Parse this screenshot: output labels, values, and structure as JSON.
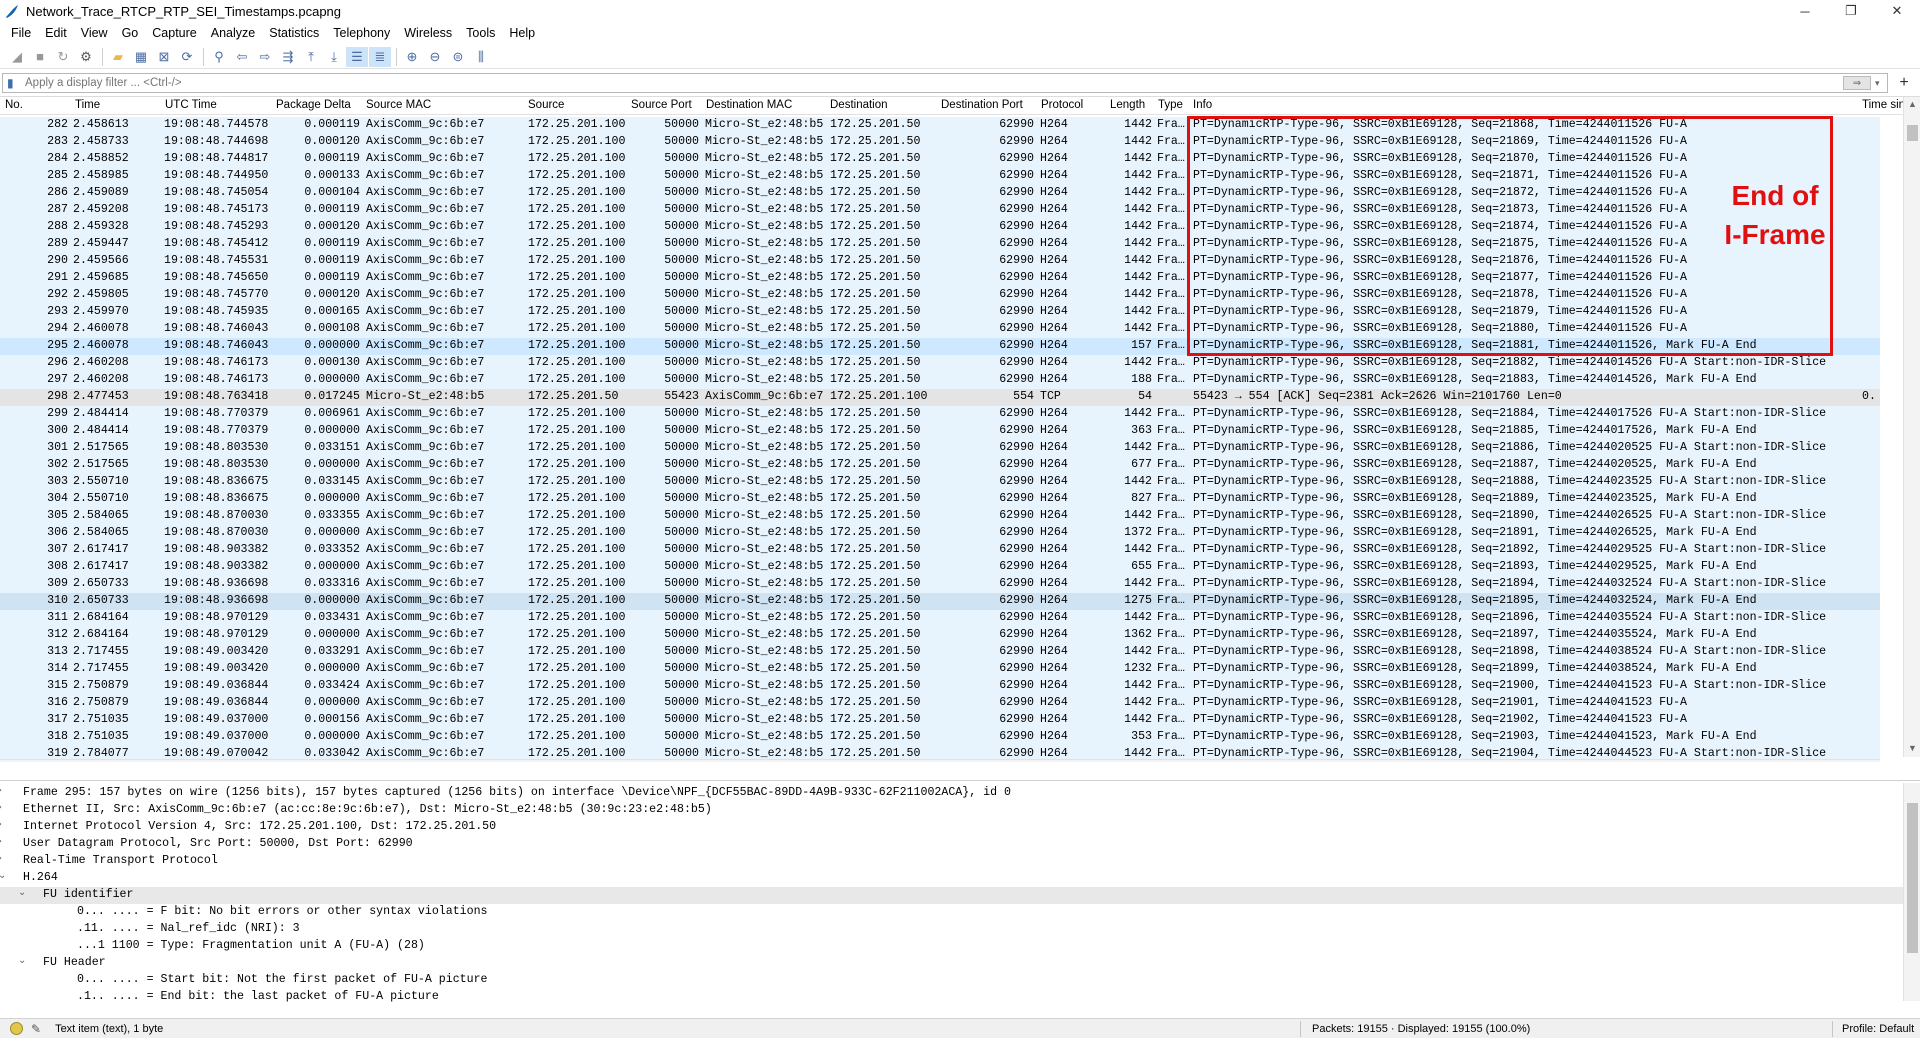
{
  "window": {
    "title": "Network_Trace_RTCP_RTP_SEI_Timestamps.pcapng"
  },
  "menu": [
    "File",
    "Edit",
    "View",
    "Go",
    "Capture",
    "Analyze",
    "Statistics",
    "Telephony",
    "Wireless",
    "Tools",
    "Help"
  ],
  "filter": {
    "placeholder": "Apply a display filter ... <Ctrl-/>"
  },
  "columns": {
    "no": "No.",
    "time": "Time",
    "utc": "UTC Time",
    "delta": "Package Delta",
    "smac": "Source MAC",
    "src": "Source",
    "sport": "Source Port",
    "dmac": "Destination MAC",
    "dst": "Destination",
    "dport": "Destination Port",
    "proto": "Protocol",
    "len": "Length",
    "type": "Type",
    "info": "Info",
    "tsin": "Time sin"
  },
  "rows": [
    [
      "282",
      "2.458613",
      "19:08:48.744578",
      "0.000119",
      "AxisComm_9c:6b:e7",
      "172.25.201.100",
      "50000",
      "Micro-St_e2:48:b5",
      "172.25.201.50",
      "62990",
      "H264",
      "1442",
      "Fra…",
      "PT=DynamicRTP-Type-96, SSRC=0xB1E69128, Seq=21868, Time=4244011526 FU-A",
      ""
    ],
    [
      "283",
      "2.458733",
      "19:08:48.744698",
      "0.000120",
      "AxisComm_9c:6b:e7",
      "172.25.201.100",
      "50000",
      "Micro-St_e2:48:b5",
      "172.25.201.50",
      "62990",
      "H264",
      "1442",
      "Fra…",
      "PT=DynamicRTP-Type-96, SSRC=0xB1E69128, Seq=21869, Time=4244011526 FU-A",
      ""
    ],
    [
      "284",
      "2.458852",
      "19:08:48.744817",
      "0.000119",
      "AxisComm_9c:6b:e7",
      "172.25.201.100",
      "50000",
      "Micro-St_e2:48:b5",
      "172.25.201.50",
      "62990",
      "H264",
      "1442",
      "Fra…",
      "PT=DynamicRTP-Type-96, SSRC=0xB1E69128, Seq=21870, Time=4244011526 FU-A",
      ""
    ],
    [
      "285",
      "2.458985",
      "19:08:48.744950",
      "0.000133",
      "AxisComm_9c:6b:e7",
      "172.25.201.100",
      "50000",
      "Micro-St_e2:48:b5",
      "172.25.201.50",
      "62990",
      "H264",
      "1442",
      "Fra…",
      "PT=DynamicRTP-Type-96, SSRC=0xB1E69128, Seq=21871, Time=4244011526 FU-A",
      ""
    ],
    [
      "286",
      "2.459089",
      "19:08:48.745054",
      "0.000104",
      "AxisComm_9c:6b:e7",
      "172.25.201.100",
      "50000",
      "Micro-St_e2:48:b5",
      "172.25.201.50",
      "62990",
      "H264",
      "1442",
      "Fra…",
      "PT=DynamicRTP-Type-96, SSRC=0xB1E69128, Seq=21872, Time=4244011526 FU-A",
      ""
    ],
    [
      "287",
      "2.459208",
      "19:08:48.745173",
      "0.000119",
      "AxisComm_9c:6b:e7",
      "172.25.201.100",
      "50000",
      "Micro-St_e2:48:b5",
      "172.25.201.50",
      "62990",
      "H264",
      "1442",
      "Fra…",
      "PT=DynamicRTP-Type-96, SSRC=0xB1E69128, Seq=21873, Time=4244011526 FU-A",
      ""
    ],
    [
      "288",
      "2.459328",
      "19:08:48.745293",
      "0.000120",
      "AxisComm_9c:6b:e7",
      "172.25.201.100",
      "50000",
      "Micro-St_e2:48:b5",
      "172.25.201.50",
      "62990",
      "H264",
      "1442",
      "Fra…",
      "PT=DynamicRTP-Type-96, SSRC=0xB1E69128, Seq=21874, Time=4244011526 FU-A",
      ""
    ],
    [
      "289",
      "2.459447",
      "19:08:48.745412",
      "0.000119",
      "AxisComm_9c:6b:e7",
      "172.25.201.100",
      "50000",
      "Micro-St_e2:48:b5",
      "172.25.201.50",
      "62990",
      "H264",
      "1442",
      "Fra…",
      "PT=DynamicRTP-Type-96, SSRC=0xB1E69128, Seq=21875, Time=4244011526 FU-A",
      ""
    ],
    [
      "290",
      "2.459566",
      "19:08:48.745531",
      "0.000119",
      "AxisComm_9c:6b:e7",
      "172.25.201.100",
      "50000",
      "Micro-St_e2:48:b5",
      "172.25.201.50",
      "62990",
      "H264",
      "1442",
      "Fra…",
      "PT=DynamicRTP-Type-96, SSRC=0xB1E69128, Seq=21876, Time=4244011526 FU-A",
      ""
    ],
    [
      "291",
      "2.459685",
      "19:08:48.745650",
      "0.000119",
      "AxisComm_9c:6b:e7",
      "172.25.201.100",
      "50000",
      "Micro-St_e2:48:b5",
      "172.25.201.50",
      "62990",
      "H264",
      "1442",
      "Fra…",
      "PT=DynamicRTP-Type-96, SSRC=0xB1E69128, Seq=21877, Time=4244011526 FU-A",
      ""
    ],
    [
      "292",
      "2.459805",
      "19:08:48.745770",
      "0.000120",
      "AxisComm_9c:6b:e7",
      "172.25.201.100",
      "50000",
      "Micro-St_e2:48:b5",
      "172.25.201.50",
      "62990",
      "H264",
      "1442",
      "Fra…",
      "PT=DynamicRTP-Type-96, SSRC=0xB1E69128, Seq=21878, Time=4244011526 FU-A",
      ""
    ],
    [
      "293",
      "2.459970",
      "19:08:48.745935",
      "0.000165",
      "AxisComm_9c:6b:e7",
      "172.25.201.100",
      "50000",
      "Micro-St_e2:48:b5",
      "172.25.201.50",
      "62990",
      "H264",
      "1442",
      "Fra…",
      "PT=DynamicRTP-Type-96, SSRC=0xB1E69128, Seq=21879, Time=4244011526 FU-A",
      ""
    ],
    [
      "294",
      "2.460078",
      "19:08:48.746043",
      "0.000108",
      "AxisComm_9c:6b:e7",
      "172.25.201.100",
      "50000",
      "Micro-St_e2:48:b5",
      "172.25.201.50",
      "62990",
      "H264",
      "1442",
      "Fra…",
      "PT=DynamicRTP-Type-96, SSRC=0xB1E69128, Seq=21880, Time=4244011526 FU-A",
      ""
    ],
    [
      "295",
      "2.460078",
      "19:08:48.746043",
      "0.000000",
      "AxisComm_9c:6b:e7",
      "172.25.201.100",
      "50000",
      "Micro-St_e2:48:b5",
      "172.25.201.50",
      "62990",
      "H264",
      "157",
      "Fra…",
      "PT=DynamicRTP-Type-96, SSRC=0xB1E69128, Seq=21881, Time=4244011526, Mark FU-A End",
      ""
    ],
    [
      "296",
      "2.460208",
      "19:08:48.746173",
      "0.000130",
      "AxisComm_9c:6b:e7",
      "172.25.201.100",
      "50000",
      "Micro-St_e2:48:b5",
      "172.25.201.50",
      "62990",
      "H264",
      "1442",
      "Fra…",
      "PT=DynamicRTP-Type-96, SSRC=0xB1E69128, Seq=21882, Time=4244014526 FU-A Start:non-IDR-Slice",
      ""
    ],
    [
      "297",
      "2.460208",
      "19:08:48.746173",
      "0.000000",
      "AxisComm_9c:6b:e7",
      "172.25.201.100",
      "50000",
      "Micro-St_e2:48:b5",
      "172.25.201.50",
      "62990",
      "H264",
      "188",
      "Fra…",
      "PT=DynamicRTP-Type-96, SSRC=0xB1E69128, Seq=21883, Time=4244014526, Mark FU-A End",
      ""
    ],
    [
      "298",
      "2.477453",
      "19:08:48.763418",
      "0.017245",
      "Micro-St_e2:48:b5",
      "172.25.201.50",
      "55423",
      "AxisComm_9c:6b:e7",
      "172.25.201.100",
      "554",
      "TCP",
      "54",
      "",
      "55423 → 554 [ACK] Seq=2381 Ack=2626 Win=2101760 Len=0",
      "0."
    ],
    [
      "299",
      "2.484414",
      "19:08:48.770379",
      "0.006961",
      "AxisComm_9c:6b:e7",
      "172.25.201.100",
      "50000",
      "Micro-St_e2:48:b5",
      "172.25.201.50",
      "62990",
      "H264",
      "1442",
      "Fra…",
      "PT=DynamicRTP-Type-96, SSRC=0xB1E69128, Seq=21884, Time=4244017526 FU-A Start:non-IDR-Slice",
      ""
    ],
    [
      "300",
      "2.484414",
      "19:08:48.770379",
      "0.000000",
      "AxisComm_9c:6b:e7",
      "172.25.201.100",
      "50000",
      "Micro-St_e2:48:b5",
      "172.25.201.50",
      "62990",
      "H264",
      "363",
      "Fra…",
      "PT=DynamicRTP-Type-96, SSRC=0xB1E69128, Seq=21885, Time=4244017526, Mark FU-A End",
      ""
    ],
    [
      "301",
      "2.517565",
      "19:08:48.803530",
      "0.033151",
      "AxisComm_9c:6b:e7",
      "172.25.201.100",
      "50000",
      "Micro-St_e2:48:b5",
      "172.25.201.50",
      "62990",
      "H264",
      "1442",
      "Fra…",
      "PT=DynamicRTP-Type-96, SSRC=0xB1E69128, Seq=21886, Time=4244020525 FU-A Start:non-IDR-Slice",
      ""
    ],
    [
      "302",
      "2.517565",
      "19:08:48.803530",
      "0.000000",
      "AxisComm_9c:6b:e7",
      "172.25.201.100",
      "50000",
      "Micro-St_e2:48:b5",
      "172.25.201.50",
      "62990",
      "H264",
      "677",
      "Fra…",
      "PT=DynamicRTP-Type-96, SSRC=0xB1E69128, Seq=21887, Time=4244020525, Mark FU-A End",
      ""
    ],
    [
      "303",
      "2.550710",
      "19:08:48.836675",
      "0.033145",
      "AxisComm_9c:6b:e7",
      "172.25.201.100",
      "50000",
      "Micro-St_e2:48:b5",
      "172.25.201.50",
      "62990",
      "H264",
      "1442",
      "Fra…",
      "PT=DynamicRTP-Type-96, SSRC=0xB1E69128, Seq=21888, Time=4244023525 FU-A Start:non-IDR-Slice",
      ""
    ],
    [
      "304",
      "2.550710",
      "19:08:48.836675",
      "0.000000",
      "AxisComm_9c:6b:e7",
      "172.25.201.100",
      "50000",
      "Micro-St_e2:48:b5",
      "172.25.201.50",
      "62990",
      "H264",
      "827",
      "Fra…",
      "PT=DynamicRTP-Type-96, SSRC=0xB1E69128, Seq=21889, Time=4244023525, Mark FU-A End",
      ""
    ],
    [
      "305",
      "2.584065",
      "19:08:48.870030",
      "0.033355",
      "AxisComm_9c:6b:e7",
      "172.25.201.100",
      "50000",
      "Micro-St_e2:48:b5",
      "172.25.201.50",
      "62990",
      "H264",
      "1442",
      "Fra…",
      "PT=DynamicRTP-Type-96, SSRC=0xB1E69128, Seq=21890, Time=4244026525 FU-A Start:non-IDR-Slice",
      ""
    ],
    [
      "306",
      "2.584065",
      "19:08:48.870030",
      "0.000000",
      "AxisComm_9c:6b:e7",
      "172.25.201.100",
      "50000",
      "Micro-St_e2:48:b5",
      "172.25.201.50",
      "62990",
      "H264",
      "1372",
      "Fra…",
      "PT=DynamicRTP-Type-96, SSRC=0xB1E69128, Seq=21891, Time=4244026525, Mark FU-A End",
      ""
    ],
    [
      "307",
      "2.617417",
      "19:08:48.903382",
      "0.033352",
      "AxisComm_9c:6b:e7",
      "172.25.201.100",
      "50000",
      "Micro-St_e2:48:b5",
      "172.25.201.50",
      "62990",
      "H264",
      "1442",
      "Fra…",
      "PT=DynamicRTP-Type-96, SSRC=0xB1E69128, Seq=21892, Time=4244029525 FU-A Start:non-IDR-Slice",
      ""
    ],
    [
      "308",
      "2.617417",
      "19:08:48.903382",
      "0.000000",
      "AxisComm_9c:6b:e7",
      "172.25.201.100",
      "50000",
      "Micro-St_e2:48:b5",
      "172.25.201.50",
      "62990",
      "H264",
      "655",
      "Fra…",
      "PT=DynamicRTP-Type-96, SSRC=0xB1E69128, Seq=21893, Time=4244029525, Mark FU-A End",
      ""
    ],
    [
      "309",
      "2.650733",
      "19:08:48.936698",
      "0.033316",
      "AxisComm_9c:6b:e7",
      "172.25.201.100",
      "50000",
      "Micro-St_e2:48:b5",
      "172.25.201.50",
      "62990",
      "H264",
      "1442",
      "Fra…",
      "PT=DynamicRTP-Type-96, SSRC=0xB1E69128, Seq=21894, Time=4244032524 FU-A Start:non-IDR-Slice",
      ""
    ],
    [
      "310",
      "2.650733",
      "19:08:48.936698",
      "0.000000",
      "AxisComm_9c:6b:e7",
      "172.25.201.100",
      "50000",
      "Micro-St_e2:48:b5",
      "172.25.201.50",
      "62990",
      "H264",
      "1275",
      "Fra…",
      "PT=DynamicRTP-Type-96, SSRC=0xB1E69128, Seq=21895, Time=4244032524, Mark FU-A End",
      ""
    ],
    [
      "311",
      "2.684164",
      "19:08:48.970129",
      "0.033431",
      "AxisComm_9c:6b:e7",
      "172.25.201.100",
      "50000",
      "Micro-St_e2:48:b5",
      "172.25.201.50",
      "62990",
      "H264",
      "1442",
      "Fra…",
      "PT=DynamicRTP-Type-96, SSRC=0xB1E69128, Seq=21896, Time=4244035524 FU-A Start:non-IDR-Slice",
      ""
    ],
    [
      "312",
      "2.684164",
      "19:08:48.970129",
      "0.000000",
      "AxisComm_9c:6b:e7",
      "172.25.201.100",
      "50000",
      "Micro-St_e2:48:b5",
      "172.25.201.50",
      "62990",
      "H264",
      "1362",
      "Fra…",
      "PT=DynamicRTP-Type-96, SSRC=0xB1E69128, Seq=21897, Time=4244035524, Mark FU-A End",
      ""
    ],
    [
      "313",
      "2.717455",
      "19:08:49.003420",
      "0.033291",
      "AxisComm_9c:6b:e7",
      "172.25.201.100",
      "50000",
      "Micro-St_e2:48:b5",
      "172.25.201.50",
      "62990",
      "H264",
      "1442",
      "Fra…",
      "PT=DynamicRTP-Type-96, SSRC=0xB1E69128, Seq=21898, Time=4244038524 FU-A Start:non-IDR-Slice",
      ""
    ],
    [
      "314",
      "2.717455",
      "19:08:49.003420",
      "0.000000",
      "AxisComm_9c:6b:e7",
      "172.25.201.100",
      "50000",
      "Micro-St_e2:48:b5",
      "172.25.201.50",
      "62990",
      "H264",
      "1232",
      "Fra…",
      "PT=DynamicRTP-Type-96, SSRC=0xB1E69128, Seq=21899, Time=4244038524, Mark FU-A End",
      ""
    ],
    [
      "315",
      "2.750879",
      "19:08:49.036844",
      "0.033424",
      "AxisComm_9c:6b:e7",
      "172.25.201.100",
      "50000",
      "Micro-St_e2:48:b5",
      "172.25.201.50",
      "62990",
      "H264",
      "1442",
      "Fra…",
      "PT=DynamicRTP-Type-96, SSRC=0xB1E69128, Seq=21900, Time=4244041523 FU-A Start:non-IDR-Slice",
      ""
    ],
    [
      "316",
      "2.750879",
      "19:08:49.036844",
      "0.000000",
      "AxisComm_9c:6b:e7",
      "172.25.201.100",
      "50000",
      "Micro-St_e2:48:b5",
      "172.25.201.50",
      "62990",
      "H264",
      "1442",
      "Fra…",
      "PT=DynamicRTP-Type-96, SSRC=0xB1E69128, Seq=21901, Time=4244041523 FU-A",
      ""
    ],
    [
      "317",
      "2.751035",
      "19:08:49.037000",
      "0.000156",
      "AxisComm_9c:6b:e7",
      "172.25.201.100",
      "50000",
      "Micro-St_e2:48:b5",
      "172.25.201.50",
      "62990",
      "H264",
      "1442",
      "Fra…",
      "PT=DynamicRTP-Type-96, SSRC=0xB1E69128, Seq=21902, Time=4244041523 FU-A",
      ""
    ],
    [
      "318",
      "2.751035",
      "19:08:49.037000",
      "0.000000",
      "AxisComm_9c:6b:e7",
      "172.25.201.100",
      "50000",
      "Micro-St_e2:48:b5",
      "172.25.201.50",
      "62990",
      "H264",
      "353",
      "Fra…",
      "PT=DynamicRTP-Type-96, SSRC=0xB1E69128, Seq=21903, Time=4244041523, Mark FU-A End",
      ""
    ],
    [
      "319",
      "2.784077",
      "19:08:49.070042",
      "0.033042",
      "AxisComm_9c:6b:e7",
      "172.25.201.100",
      "50000",
      "Micro-St_e2:48:b5",
      "172.25.201.50",
      "62990",
      "H264",
      "1442",
      "Fra…",
      "PT=DynamicRTP-Type-96, SSRC=0xB1E69128, Seq=21904, Time=4244044523 FU-A Start:non-IDR-Slice",
      ""
    ]
  ],
  "annotation": {
    "line1": "End of",
    "line2": "I-Frame",
    "color": "#e01010"
  },
  "details": [
    {
      "indent": 0,
      "arrow": "›",
      "text": "Frame 295: 157 bytes on wire (1256 bits), 157 bytes captured (1256 bits) on interface \\Device\\NPF_{DCF55BAC-89DD-4A9B-933C-62F211002ACA}, id 0"
    },
    {
      "indent": 0,
      "arrow": "›",
      "text": "Ethernet II, Src: AxisComm_9c:6b:e7 (ac:cc:8e:9c:6b:e7), Dst: Micro-St_e2:48:b5 (30:9c:23:e2:48:b5)"
    },
    {
      "indent": 0,
      "arrow": "›",
      "text": "Internet Protocol Version 4, Src: 172.25.201.100, Dst: 172.25.201.50"
    },
    {
      "indent": 0,
      "arrow": "›",
      "text": "User Datagram Protocol, Src Port: 50000, Dst Port: 62990"
    },
    {
      "indent": 0,
      "arrow": "›",
      "text": "Real-Time Transport Protocol"
    },
    {
      "indent": 0,
      "arrow": "⌄",
      "text": "H.264"
    },
    {
      "indent": 1,
      "arrow": "⌄",
      "text": "FU identifier"
    },
    {
      "indent": 2,
      "arrow": "",
      "text": "0... .... = F bit: No bit errors or other syntax violations"
    },
    {
      "indent": 2,
      "arrow": "",
      "text": ".11. .... = Nal_ref_idc (NRI): 3"
    },
    {
      "indent": 2,
      "arrow": "",
      "text": "...1 1100 = Type: Fragmentation unit A (FU-A) (28)"
    },
    {
      "indent": 1,
      "arrow": "⌄",
      "text": "FU Header"
    },
    {
      "indent": 2,
      "arrow": "",
      "text": "0... .... = Start bit: Not the first packet of FU-A picture"
    },
    {
      "indent": 2,
      "arrow": "",
      "text": ".1.. .... = End bit: the last packet of FU-A picture"
    }
  ],
  "status": {
    "text": "Text item (text), 1 byte",
    "packets": "Packets: 19155 · Displayed: 19155 (100.0%)",
    "profile": "Profile: Default"
  }
}
